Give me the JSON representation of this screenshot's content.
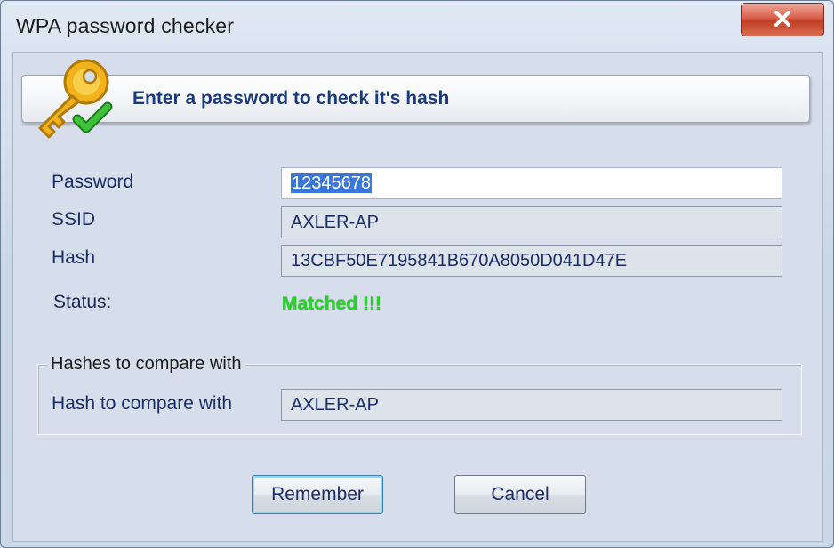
{
  "window": {
    "title": "WPA password checker"
  },
  "header": {
    "text": "Enter a password to check it's hash"
  },
  "form": {
    "password_label": "Password",
    "password_value": "12345678",
    "ssid_label": "SSID",
    "ssid_value": "AXLER-AP",
    "hash_label": "Hash",
    "hash_value": "13CBF50E7195841B670A8050D041D47E",
    "status_label": "Status:",
    "status_value": "Matched !!!"
  },
  "compare_group": {
    "title": "Hashes to compare with",
    "field_label": "Hash to compare with",
    "field_value": "AXLER-AP"
  },
  "buttons": {
    "remember": "Remember",
    "cancel": "Cancel"
  },
  "icons": {
    "close": "close-icon",
    "key": "key-check-icon"
  },
  "colors": {
    "status_matched": "#29d12a",
    "label_text": "#1b2d66",
    "close_button": "#d9604c",
    "selection": "#3b77d8"
  }
}
